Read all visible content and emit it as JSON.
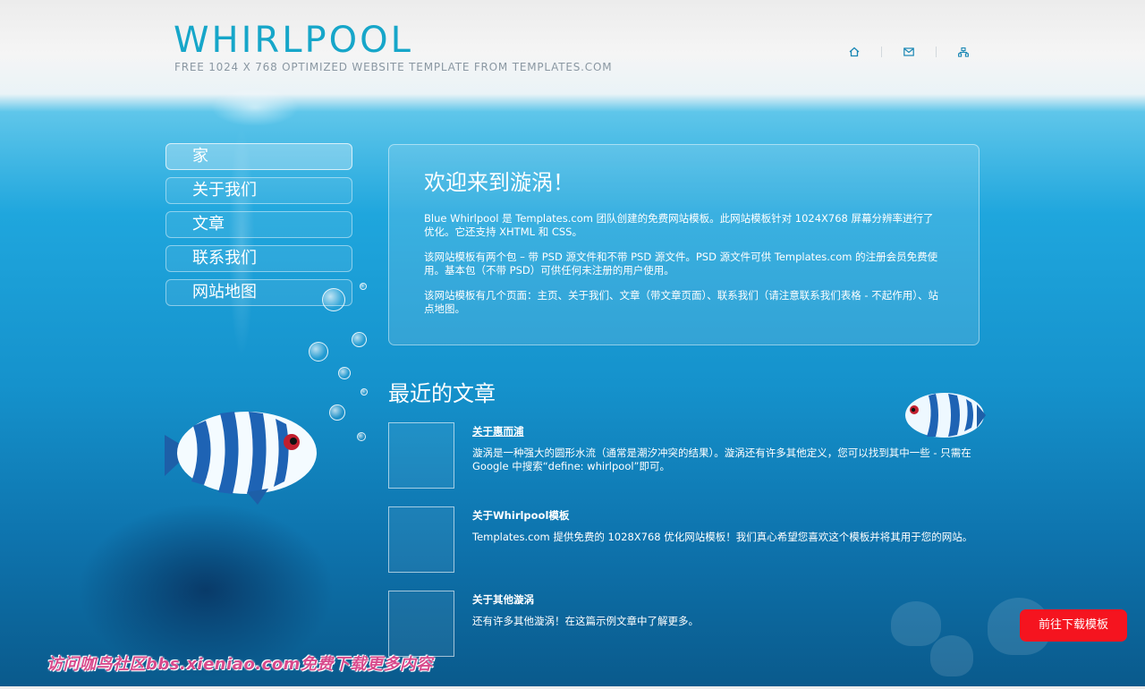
{
  "header": {
    "logo": "WHIRLPOOL",
    "tagline": "FREE 1024 X 768 OPTIMIZED WEBSITE TEMPLATE FROM TEMPLATES.COM",
    "icons": [
      "home-icon",
      "mail-icon",
      "sitemap-icon"
    ]
  },
  "sidenav": {
    "items": [
      {
        "label": "家"
      },
      {
        "label": "关于我们"
      },
      {
        "label": "文章"
      },
      {
        "label": "联系我们"
      },
      {
        "label": "网站地图"
      }
    ]
  },
  "welcome": {
    "title": "欢迎来到漩涡！",
    "p1": "Blue Whirlpool 是 Templates.com 团队创建的免费网站模板。此网站模板针对 1024X768 屏幕分辨率进行了优化。它还支持 XHTML 和 CSS。",
    "p2": "该网站模板有两个包 – 带 PSD 源文件和不带 PSD 源文件。PSD 源文件可供 Templates.com 的注册会员免费使用。基本包（不带 PSD）可供任何未注册的用户使用。",
    "p3": "该网站模板有几个页面：主页、关于我们、文章（带文章页面）、联系我们（请注意联系我们表格 - 不起作用）、站点地图。"
  },
  "recent": {
    "title": "最近的文章",
    "articles": [
      {
        "title": "关于惠而浦",
        "text": "漩涡是一种强大的圆形水流（通常是潮汐冲突的结果）。漩涡还有许多其他定义，您可以找到其中一些 - 只需在 Google 中搜索“define: whirlpool”即可。"
      },
      {
        "title": "关于Whirlpool模板",
        "text": "Templates.com 提供免费的 1028X768 优化网站模板！我们真心希望您喜欢这个模板并将其用于您的网站。"
      },
      {
        "title": "关于其他漩涡",
        "text": "还有许多其他漩涡！在这篇示例文章中了解更多。"
      }
    ]
  },
  "download_button": "前往下载模板",
  "watermark": "访问咖鸟社区bbs.xieniao.com免费下载更多内容",
  "colors": {
    "accent": "#16a6c9",
    "button": "#f5141f",
    "watermark": "#d84a8c"
  }
}
